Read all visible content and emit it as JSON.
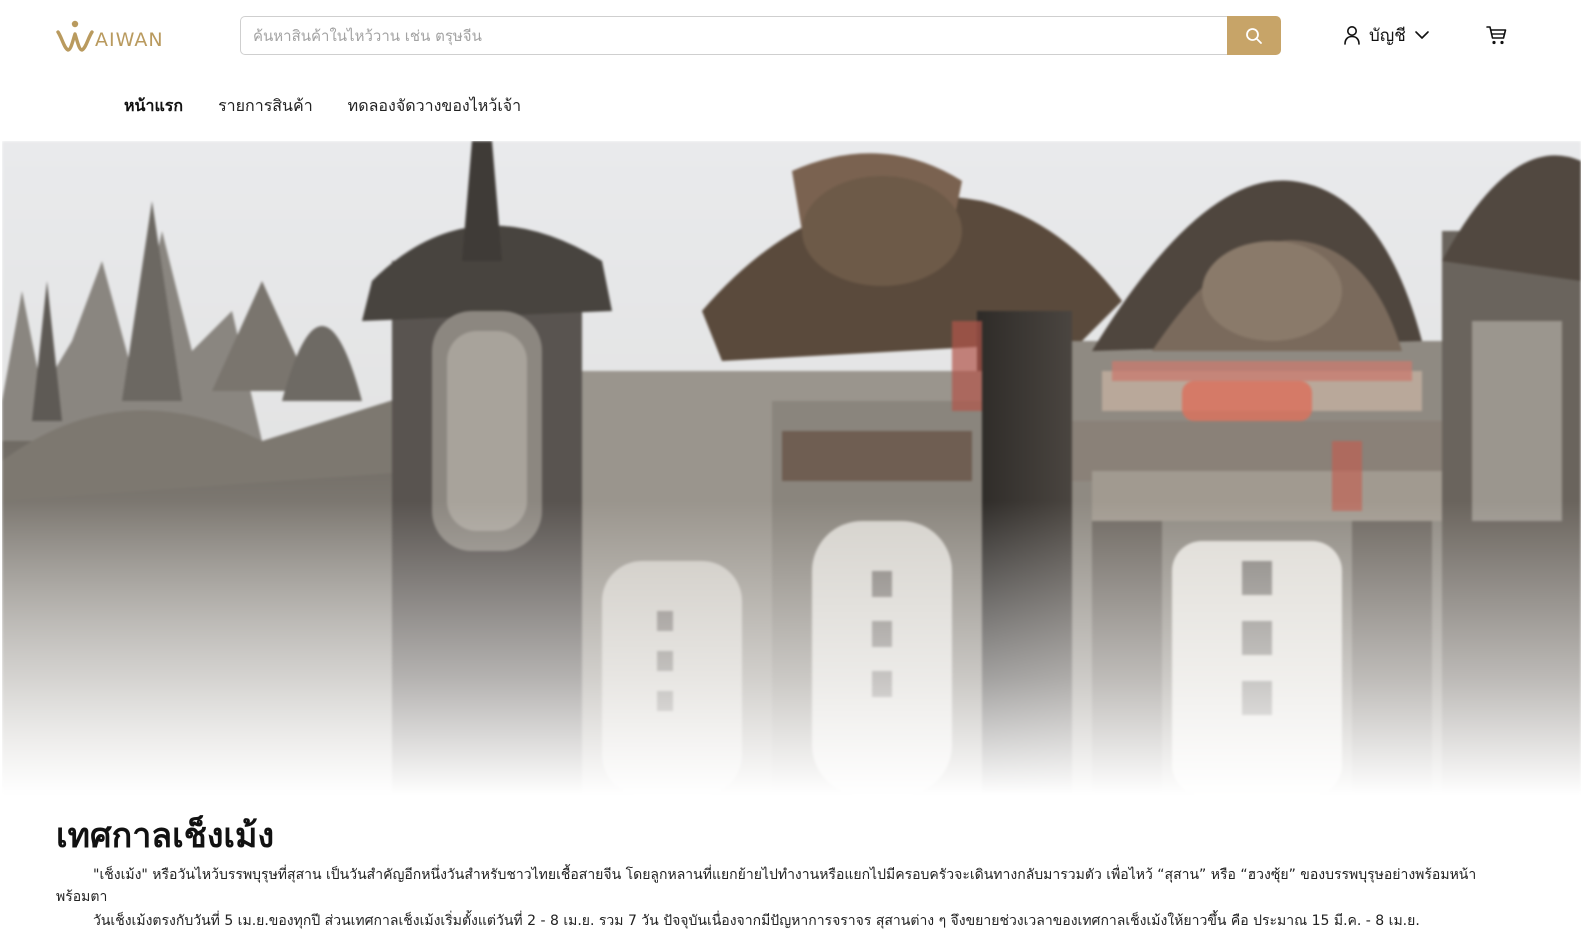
{
  "brand": {
    "logo_text": "AIWAN",
    "accent": "#c7a468",
    "logo_color": "#b99a5e"
  },
  "search": {
    "placeholder": "ค้นหาสินค้าในไหว้วาน เช่น ตรุษจีน",
    "value": "",
    "button_icon": "search-icon"
  },
  "account": {
    "label": "บัญชี",
    "icon": "user-icon",
    "dropdown_icon": "chevron-down-icon"
  },
  "cart": {
    "icon": "cart-icon"
  },
  "nav": {
    "items": [
      {
        "label": "หน้าแรก"
      },
      {
        "label": "รายการสินค้า"
      },
      {
        "label": "ทดลองจัดวางของไหว้เจ้า"
      }
    ]
  },
  "article": {
    "title": "เทศกาลเช็งเม้ง",
    "paragraphs": [
      "\"เช็งเม้ง\" หรือวันไหว้บรรพบุรุษที่สุสาน เป็นวันสำคัญอีกหนึ่งวันสำหรับชาวไทยเชื้อสายจีน โดยลูกหลานที่แยกย้ายไปทำงานหรือแยกไปมีครอบครัวจะเดินทางกลับมารวมตัว เพื่อไหว้ “สุสาน” หรือ “ฮวงซุ้ย” ของบรรพบุรุษอย่างพร้อมหน้าพร้อมตา",
      "วันเช็งเม้งตรงกับวันที่ 5 เม.ย.ของทุกปี ส่วนเทศกาลเช็งเม้งเริ่มตั้งแต่วันที่ 2 - 8 เม.ย. รวม 7 วัน ปัจจุบันเนื่องจากมีปัญหาการจราจร สุสานต่าง ๆ จึงขยายช่วงเวลาของเทศกาลเช็งเม้งให้ยาวขึ้น คือ ประมาณ 15 มี.ค. - 8 เม.ย."
    ]
  }
}
